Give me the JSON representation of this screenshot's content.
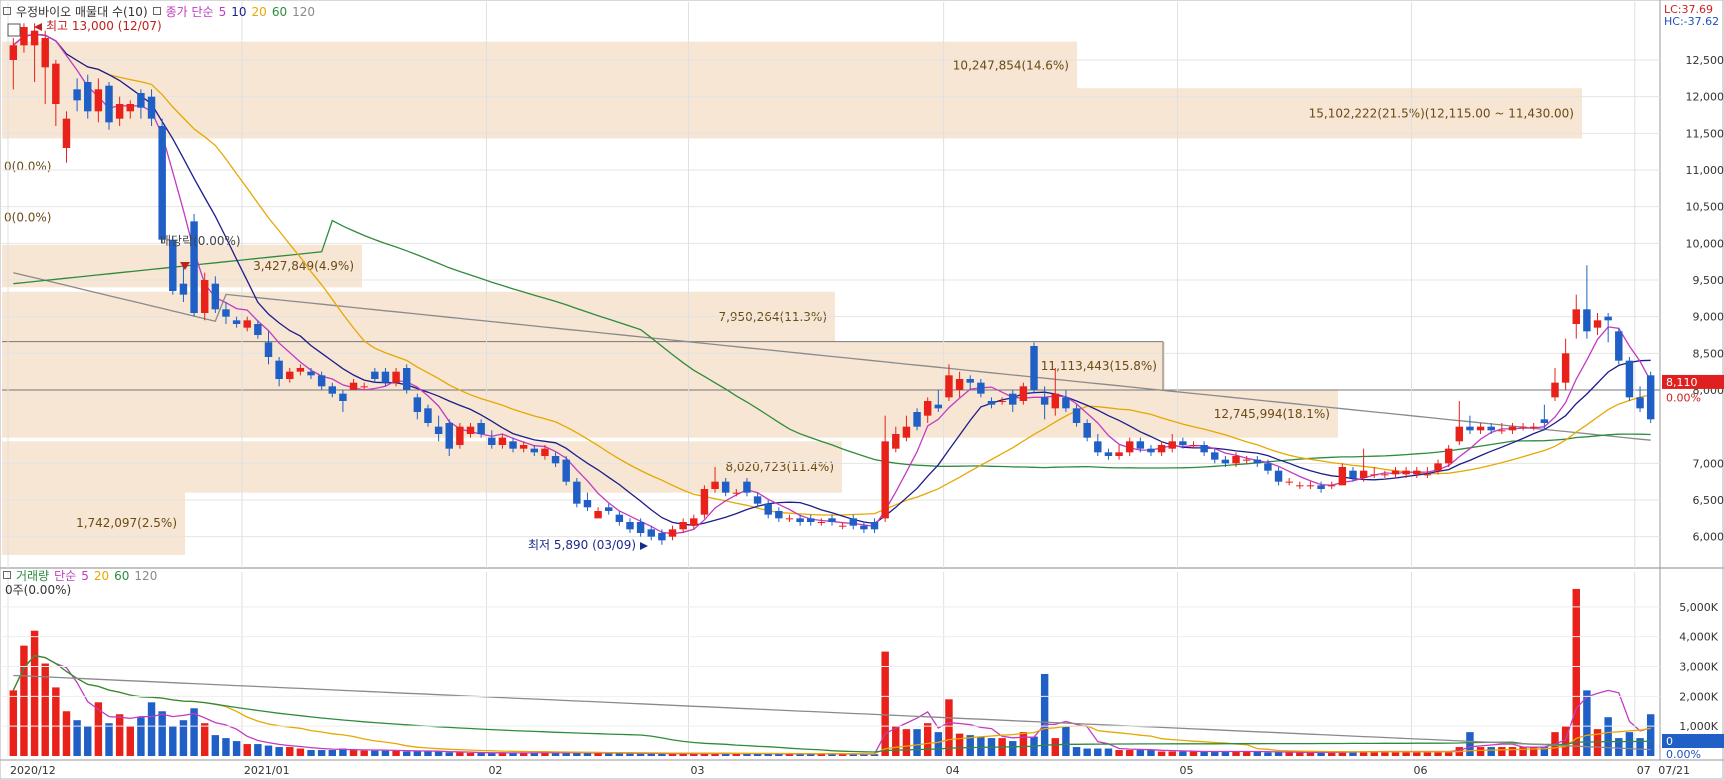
{
  "price_legend": {
    "title": "우정바이오 매물대 수(10)",
    "ma_label": "종가 단순",
    "ma": [
      "5",
      "10",
      "20",
      "60",
      "120"
    ]
  },
  "volume_legend": {
    "title": "거래량",
    "ma_label": "단순",
    "ma": [
      "5",
      "20",
      "60",
      "120"
    ]
  },
  "corner": {
    "lc": "LC:37.69",
    "hc": "HC:-37.62"
  },
  "colors": {
    "up": "#e8211a",
    "down": "#1f5fc6",
    "ma5": "#c23bc2",
    "ma10": "#1c1c8c",
    "ma20": "#e6a800",
    "ma60": "#2e8b3d",
    "ma120": "#8a8a8a",
    "band": "#f6e6d3",
    "band_text": "#6b4b16"
  },
  "annotations": {
    "high": "최고 13,000 (12/07)",
    "low": "최저 5,890 (03/09)",
    "dividend": "배당락(0.00%)",
    "zero1": "0(0.0%)",
    "zero2": "0(0.0%)",
    "vol_zero": "0주(0.00%)"
  },
  "current_price_tag": {
    "price": "8,110",
    "pct": "0.00%"
  },
  "volume_tag": {
    "v": "0",
    "pct": "0.00%"
  },
  "chart_data": [
    {
      "type": "candlestick",
      "title": "우정바이오 매물대 수(10)",
      "ylim": [
        5600,
        13100
      ],
      "y_ticks": [
        "12,500",
        "12,000",
        "11,500",
        "11,000",
        "10,500",
        "10,000",
        "9,500",
        "9,000",
        "8,500",
        "8,000",
        "7,000",
        "6,500",
        "6,000"
      ],
      "x_ticks": [
        "2020/12",
        "2021/01",
        "02",
        "03",
        "04",
        "05",
        "06",
        "07",
        "07/21"
      ],
      "candles": [
        [
          12500,
          12700,
          12100,
          12800
        ],
        [
          12700,
          12950,
          12600,
          13000
        ],
        [
          12700,
          12900,
          12200,
          13000
        ],
        [
          12400,
          12800,
          11900,
          12900
        ],
        [
          11900,
          12450,
          11600,
          12500
        ],
        [
          11300,
          11700,
          11100,
          11800
        ],
        [
          12100,
          11950,
          11800,
          12250
        ],
        [
          12200,
          11800,
          11700,
          12300
        ],
        [
          11800,
          12100,
          11650,
          12250
        ],
        [
          12150,
          11650,
          11550,
          12200
        ],
        [
          11700,
          11900,
          11600,
          12000
        ],
        [
          11800,
          11900,
          11700,
          11950
        ],
        [
          12050,
          11850,
          11700,
          12100
        ],
        [
          12000,
          11700,
          11600,
          12100
        ],
        [
          11600,
          10050,
          10000,
          11700
        ],
        [
          10050,
          9350,
          9300,
          10100
        ],
        [
          9450,
          9300,
          9200,
          9700
        ],
        [
          10300,
          9050,
          9000,
          10400
        ],
        [
          9050,
          9500,
          8950,
          9600
        ],
        [
          9450,
          9100,
          9050,
          9550
        ],
        [
          9100,
          9000,
          8900,
          9200
        ],
        [
          8950,
          8900,
          8850,
          9000
        ],
        [
          8850,
          8950,
          8800,
          9000
        ],
        [
          8900,
          8750,
          8700,
          8950
        ],
        [
          8650,
          8450,
          8350,
          8800
        ],
        [
          8400,
          8150,
          8050,
          8450
        ],
        [
          8150,
          8250,
          8100,
          8300
        ],
        [
          8250,
          8300,
          8200,
          8350
        ],
        [
          8250,
          8200,
          8150,
          8300
        ],
        [
          8200,
          8050,
          8000,
          8250
        ],
        [
          8050,
          7950,
          7900,
          8100
        ],
        [
          7950,
          7850,
          7700,
          8000
        ],
        [
          8000,
          8100,
          8000,
          8150
        ],
        [
          8050,
          8050,
          8000,
          8100
        ],
        [
          8250,
          8150,
          8100,
          8300
        ],
        [
          8250,
          8100,
          8050,
          8300
        ],
        [
          8100,
          8250,
          8050,
          8300
        ],
        [
          8300,
          8000,
          7950,
          8350
        ],
        [
          7900,
          7700,
          7600,
          7950
        ],
        [
          7750,
          7550,
          7500,
          7800
        ],
        [
          7500,
          7400,
          7300,
          7650
        ],
        [
          7550,
          7200,
          7100,
          7600
        ],
        [
          7250,
          7500,
          7200,
          7550
        ],
        [
          7400,
          7500,
          7350,
          7550
        ],
        [
          7550,
          7400,
          7350,
          7600
        ],
        [
          7350,
          7250,
          7200,
          7450
        ],
        [
          7250,
          7350,
          7200,
          7400
        ],
        [
          7300,
          7200,
          7150,
          7350
        ],
        [
          7200,
          7250,
          7150,
          7300
        ],
        [
          7200,
          7150,
          7100,
          7250
        ],
        [
          7100,
          7200,
          7050,
          7250
        ],
        [
          7100,
          7000,
          6950,
          7150
        ],
        [
          7050,
          6750,
          6700,
          7100
        ],
        [
          6750,
          6450,
          6400,
          6800
        ],
        [
          6500,
          6400,
          6350,
          6600
        ],
        [
          6250,
          6350,
          6250,
          6400
        ],
        [
          6400,
          6350,
          6300,
          6450
        ],
        [
          6300,
          6200,
          6150,
          6350
        ],
        [
          6200,
          6100,
          6050,
          6250
        ],
        [
          6200,
          6050,
          6000,
          6250
        ],
        [
          6100,
          6000,
          5950,
          6150
        ],
        [
          6050,
          5950,
          5890,
          6100
        ],
        [
          6000,
          6100,
          5950,
          6150
        ],
        [
          6100,
          6200,
          6050,
          6250
        ],
        [
          6150,
          6250,
          6100,
          6300
        ],
        [
          6300,
          6650,
          6250,
          6700
        ],
        [
          6650,
          6750,
          6600,
          6950
        ],
        [
          6750,
          6600,
          6550,
          6800
        ],
        [
          6600,
          6600,
          6550,
          6650
        ],
        [
          6750,
          6600,
          6550,
          6800
        ],
        [
          6550,
          6450,
          6400,
          6600
        ],
        [
          6450,
          6300,
          6250,
          6500
        ],
        [
          6350,
          6250,
          6200,
          6400
        ],
        [
          6250,
          6250,
          6200,
          6300
        ],
        [
          6250,
          6200,
          6150,
          6300
        ],
        [
          6250,
          6200,
          6150,
          6300
        ],
        [
          6200,
          6200,
          6150,
          6250
        ],
        [
          6250,
          6200,
          6150,
          6300
        ],
        [
          6150,
          6150,
          6100,
          6200
        ],
        [
          6250,
          6150,
          6100,
          6300
        ],
        [
          6150,
          6100,
          6050,
          6200
        ],
        [
          6200,
          6100,
          6050,
          6250
        ],
        [
          6250,
          7300,
          6200,
          7650
        ],
        [
          7200,
          7400,
          7150,
          7500
        ],
        [
          7350,
          7500,
          7300,
          7650
        ],
        [
          7700,
          7500,
          7450,
          7750
        ],
        [
          7650,
          7850,
          7550,
          7900
        ],
        [
          7800,
          7750,
          7700,
          8000
        ],
        [
          7900,
          8200,
          7850,
          8350
        ],
        [
          8000,
          8150,
          7900,
          8250
        ],
        [
          8150,
          8100,
          8000,
          8200
        ],
        [
          8100,
          7950,
          7900,
          8150
        ],
        [
          7850,
          7800,
          7750,
          7900
        ],
        [
          7850,
          7850,
          7800,
          7900
        ],
        [
          7950,
          7800,
          7700,
          8000
        ],
        [
          7850,
          8050,
          7800,
          8100
        ],
        [
          8600,
          8000,
          7950,
          8650
        ],
        [
          7900,
          7800,
          7600,
          8050
        ],
        [
          7750,
          7950,
          7650,
          8300
        ],
        [
          7900,
          7750,
          7700,
          8000
        ],
        [
          7750,
          7550,
          7500,
          7800
        ],
        [
          7550,
          7350,
          7300,
          7600
        ],
        [
          7300,
          7150,
          7100,
          7400
        ],
        [
          7150,
          7100,
          7050,
          7200
        ],
        [
          7100,
          7150,
          7050,
          7250
        ],
        [
          7150,
          7300,
          7100,
          7350
        ],
        [
          7300,
          7200,
          7150,
          7350
        ],
        [
          7200,
          7150,
          7100,
          7250
        ],
        [
          7150,
          7250,
          7100,
          7300
        ],
        [
          7200,
          7300,
          7150,
          7400
        ],
        [
          7300,
          7250,
          7200,
          7350
        ],
        [
          7250,
          7250,
          7200,
          7300
        ],
        [
          7250,
          7150,
          7100,
          7300
        ],
        [
          7150,
          7050,
          7000,
          7200
        ],
        [
          7050,
          7000,
          6950,
          7100
        ],
        [
          7000,
          7100,
          6950,
          7150
        ],
        [
          7050,
          7050,
          7000,
          7100
        ],
        [
          7050,
          7000,
          6950,
          7100
        ],
        [
          7000,
          6900,
          6850,
          7050
        ],
        [
          6900,
          6750,
          6700,
          6950
        ],
        [
          6750,
          6750,
          6700,
          6800
        ],
        [
          6700,
          6700,
          6650,
          6750
        ],
        [
          6700,
          6700,
          6650,
          6750
        ],
        [
          6700,
          6650,
          6600,
          6750
        ],
        [
          6700,
          6700,
          6650,
          6750
        ],
        [
          6700,
          6950,
          6700,
          7000
        ],
        [
          6900,
          6800,
          6750,
          6950
        ],
        [
          6800,
          6900,
          6750,
          7200
        ],
        [
          6850,
          6850,
          6800,
          6950
        ],
        [
          6850,
          6850,
          6800,
          6900
        ],
        [
          6850,
          6900,
          6800,
          6950
        ],
        [
          6850,
          6900,
          6800,
          6950
        ],
        [
          6850,
          6900,
          6800,
          6950
        ],
        [
          6850,
          6850,
          6800,
          6950
        ],
        [
          6900,
          7000,
          6850,
          7050
        ],
        [
          7000,
          7200,
          6950,
          7250
        ],
        [
          7300,
          7500,
          7250,
          7850
        ],
        [
          7500,
          7450,
          7400,
          7650
        ],
        [
          7450,
          7500,
          7400,
          7550
        ],
        [
          7500,
          7450,
          7400,
          7550
        ],
        [
          7450,
          7450,
          7400,
          7550
        ],
        [
          7450,
          7500,
          7400,
          7550
        ],
        [
          7500,
          7500,
          7450,
          7550
        ],
        [
          7500,
          7500,
          7450,
          7550
        ],
        [
          7600,
          7550,
          7450,
          7800
        ],
        [
          7900,
          8100,
          7850,
          8300
        ],
        [
          8100,
          8500,
          8000,
          8700
        ],
        [
          8900,
          9100,
          8700,
          9300
        ],
        [
          9100,
          8800,
          8700,
          9700
        ],
        [
          8850,
          8950,
          8750,
          9050
        ],
        [
          9000,
          8950,
          8650,
          9050
        ],
        [
          8800,
          8400,
          8350,
          8850
        ],
        [
          8400,
          7900,
          7850,
          8450
        ],
        [
          7900,
          7750,
          7700,
          8050
        ],
        [
          8200,
          7600,
          7550,
          8250
        ]
      ],
      "bands": [
        {
          "label": "10,247,854(14.6%)",
          "lo": 12100,
          "hi": 12750
        },
        {
          "label": "15,102,222(21.5%)(12,115.00 ~ 11,430.00)",
          "lo": 11430,
          "hi": 12115
        },
        {
          "label": "0(0.0%)",
          "lo": 11050,
          "hi": 11050
        },
        {
          "label": "0(0.0%)",
          "lo": 10350,
          "hi": 10350
        },
        {
          "label": "3,427,849(4.9%)",
          "lo": 9400,
          "hi": 9980
        },
        {
          "label": "7,950,264(11.3%)",
          "lo": 8650,
          "hi": 9340
        },
        {
          "label": "11,113,443(15.8%)",
          "lo": 8000,
          "hi": 8660
        },
        {
          "label": "12,745,994(18.1%)",
          "lo": 7350,
          "hi": 8000
        },
        {
          "label": "8,020,723(11.4%)",
          "lo": 6600,
          "hi": 7300
        },
        {
          "label": "1,742,097(2.5%)",
          "lo": 5750,
          "hi": 6620
        }
      ]
    },
    {
      "type": "bar",
      "title": "거래량",
      "ylim": [
        0,
        5900
      ],
      "y_ticks": [
        "5,000K",
        "4,000K",
        "3,000K",
        "2,000K",
        "1,000K"
      ],
      "values": [
        2200,
        3700,
        4200,
        3100,
        2300,
        1500,
        1200,
        1000,
        1800,
        1100,
        1400,
        1000,
        1300,
        1800,
        1500,
        1000,
        1200,
        1600,
        1100,
        700,
        600,
        500,
        400,
        400,
        350,
        300,
        300,
        250,
        200,
        200,
        200,
        250,
        200,
        180,
        180,
        180,
        200,
        150,
        150,
        150,
        150,
        120,
        120,
        100,
        100,
        100,
        120,
        100,
        100,
        100,
        150,
        100,
        100,
        100,
        100,
        100,
        100,
        100,
        80,
        80,
        80,
        80,
        80,
        80,
        80,
        80,
        80,
        80,
        80,
        80,
        80,
        80,
        70,
        70,
        70,
        70,
        70,
        70,
        60,
        60,
        60,
        60,
        3500,
        1000,
        900,
        900,
        1100,
        800,
        1900,
        750,
        700,
        650,
        600,
        600,
        500,
        800,
        650,
        2750,
        600,
        1000,
        300,
        250,
        250,
        250,
        200,
        200,
        200,
        200,
        150,
        150,
        150,
        150,
        150,
        150,
        150,
        150,
        150,
        150,
        120,
        120,
        120,
        120,
        120,
        120,
        120,
        150,
        150,
        150,
        150,
        150,
        150,
        150,
        150,
        150,
        150,
        150,
        300,
        800,
        300,
        300,
        300,
        300,
        300,
        300,
        300,
        800,
        1000,
        5600,
        2200,
        900,
        1300,
        600,
        800,
        600,
        1400
      ]
    }
  ]
}
